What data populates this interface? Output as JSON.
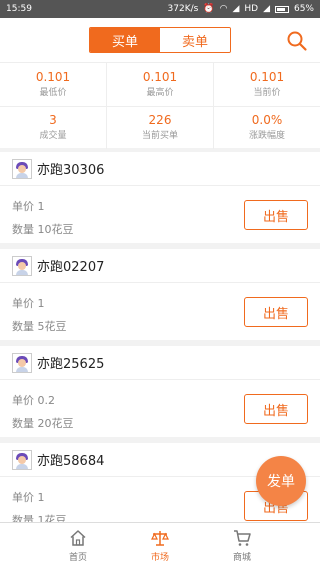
{
  "status_bar": {
    "time": "15:59",
    "network_speed": "372K/s",
    "network_type": "HD",
    "battery": "65%",
    "battery_level": 0.65
  },
  "header": {
    "tabs": [
      {
        "label": "买单",
        "active": true
      },
      {
        "label": "卖单",
        "active": false
      }
    ],
    "search_icon": "search-icon"
  },
  "stats": [
    {
      "value": "0.101",
      "label": "最低价"
    },
    {
      "value": "0.101",
      "label": "最高价"
    },
    {
      "value": "0.101",
      "label": "当前价"
    },
    {
      "value": "3",
      "label": "成交量"
    },
    {
      "value": "226",
      "label": "当前买单"
    },
    {
      "value": "0.0%",
      "label": "涨跌幅度"
    }
  ],
  "orders": [
    {
      "user": "亦跑30306",
      "price": "单价 1",
      "quantity": "数量 10花豆",
      "action": "出售"
    },
    {
      "user": "亦跑02207",
      "price": "单价 1",
      "quantity": "数量 5花豆",
      "action": "出售"
    },
    {
      "user": "亦跑25625",
      "price": "单价 0.2",
      "quantity": "数量 20花豆",
      "action": "出售"
    },
    {
      "user": "亦跑58684",
      "price": "单价 1",
      "quantity": "数量 1花豆",
      "action": "出售"
    }
  ],
  "fab": {
    "label": "发单"
  },
  "tabbar": [
    {
      "label": "首页",
      "icon": "home-icon",
      "active": false
    },
    {
      "label": "市场",
      "icon": "scale-icon",
      "active": true
    },
    {
      "label": "商城",
      "icon": "cart-icon",
      "active": false
    }
  ],
  "colors": {
    "accent": "#f06a1e",
    "fab": "#f48446"
  }
}
